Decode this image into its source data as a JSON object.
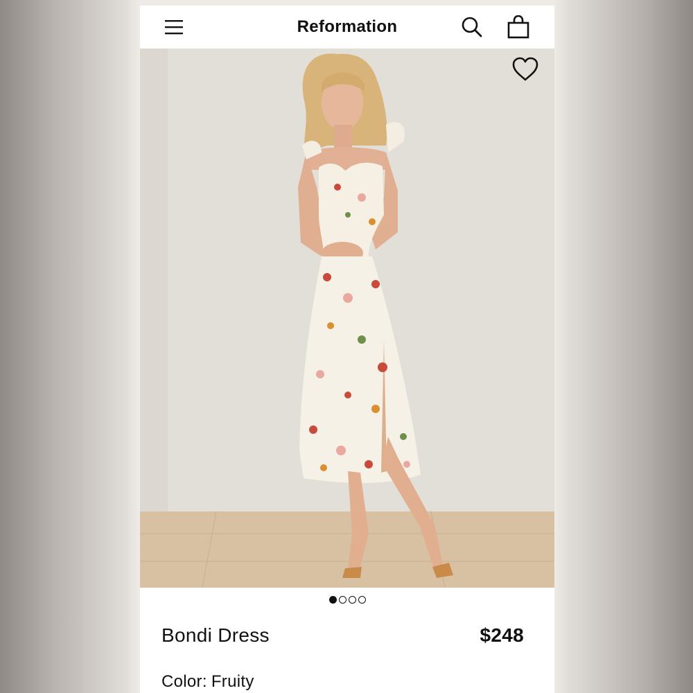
{
  "header": {
    "brand": "Reformation",
    "menu_icon": "hamburger-menu-icon",
    "search_icon": "search-icon",
    "bag_icon": "shopping-bag-icon"
  },
  "hero": {
    "image_subject": "woman wearing cream floral midi dress with ruffle straps and side slit",
    "favorite_icon": "heart-icon"
  },
  "carousel": {
    "total": 4,
    "active": 1
  },
  "product": {
    "name": "Bondi Dress",
    "price": "$248",
    "color_label": "Color:",
    "color_value": "Fruity"
  },
  "colors": {
    "text": "#111111",
    "background": "#ffffff"
  }
}
